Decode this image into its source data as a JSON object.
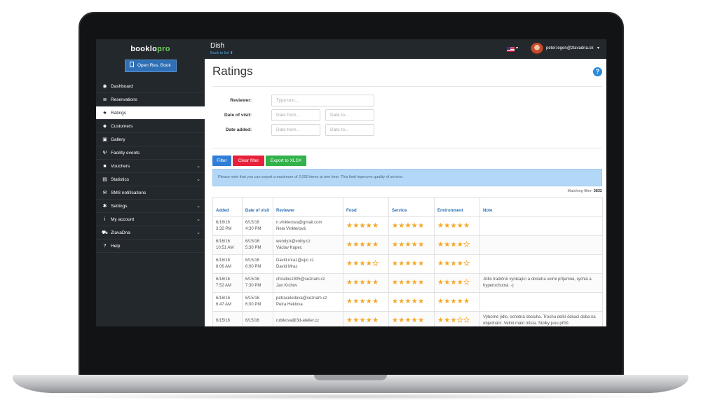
{
  "brand": {
    "name": "booklo",
    "suffix": "pro"
  },
  "header": {
    "venue": "Dish",
    "back_link": "Back to list",
    "user_email": "peter.legen@zlavadna.sk"
  },
  "sidebar": {
    "open_button": "Open Res. Book",
    "items": [
      {
        "label": "Dashboard",
        "icon": "dashboard-icon",
        "glyph": "◉"
      },
      {
        "label": "Reservations",
        "icon": "list-icon",
        "glyph": "≣"
      },
      {
        "label": "Ratings",
        "icon": "star-icon",
        "glyph": "★",
        "active": true
      },
      {
        "label": "Customers",
        "icon": "users-icon",
        "glyph": "☻"
      },
      {
        "label": "Gallery",
        "icon": "image-icon",
        "glyph": "▣"
      },
      {
        "label": "Facility events",
        "icon": "cutlery-icon",
        "glyph": "Ψ"
      },
      {
        "label": "Vouchers",
        "icon": "gift-icon",
        "glyph": "■",
        "chevron": true
      },
      {
        "label": "Statistics",
        "icon": "chart-icon",
        "glyph": "▤",
        "chevron": true
      },
      {
        "label": "SMS notifications",
        "icon": "envelope-icon",
        "glyph": "✉"
      },
      {
        "label": "Settings",
        "icon": "gear-icon",
        "glyph": "✱",
        "chevron": true
      },
      {
        "label": "My account",
        "icon": "info-icon",
        "glyph": "i",
        "chevron": true
      },
      {
        "label": "ZlavaDna",
        "icon": "cart-icon",
        "glyph": "⛟",
        "chevron": true
      },
      {
        "label": "Help",
        "icon": "help-icon",
        "glyph": "?"
      }
    ]
  },
  "page": {
    "title": "Ratings",
    "help": "?",
    "filters": {
      "reviewer_label": "Reviewer:",
      "reviewer_placeholder": "Type text...",
      "visit_label": "Date of visit:",
      "visit_from": "Date from...",
      "visit_to": "Date to...",
      "added_label": "Date added:",
      "added_from": "Date from...",
      "added_to": "Date to..."
    },
    "buttons": {
      "filter": "Filter",
      "clear": "Clear filter",
      "export": "Export to XLSX"
    },
    "notice": "Please note that you can export a maximum of 2,000 items at one time. This limit improves quality of service.",
    "matching_label": "Matching filter:",
    "matching_count": "3832",
    "colors": {
      "accent": "#2f7fd8",
      "danger": "#e8203a",
      "success": "#33b24a",
      "star": "#f5a623",
      "sidebar": "#23282d"
    }
  },
  "table": {
    "headers": [
      "Added",
      "Date of visit",
      "Reviewer",
      "Food",
      "Service",
      "Environment",
      "Note"
    ],
    "rows": [
      {
        "added_date": "6/16/16",
        "added_time": "3:32 PM",
        "visit_date": "6/15/16",
        "visit_time": "4:30 PM",
        "email": "n.vinklerova@gmail.com",
        "name": "Nela Vinklerová",
        "food": 5,
        "service": 5,
        "environment": 5,
        "note": ""
      },
      {
        "added_date": "6/16/16",
        "added_time": "10:51 AM",
        "visit_date": "6/15/16",
        "visit_time": "5:30 PM",
        "email": "wendy.k@volny.cz",
        "name": "Václav Kupec",
        "food": 5,
        "service": 5,
        "environment": 4,
        "note": ""
      },
      {
        "added_date": "6/16/16",
        "added_time": "8:06 AM",
        "visit_date": "6/15/16",
        "visit_time": "6:00 PM",
        "email": "David.mraz@upc.cz",
        "name": "David Mraz",
        "food": 4,
        "service": 5,
        "environment": 4,
        "note": ""
      },
      {
        "added_date": "6/16/16",
        "added_time": "7:52 AM",
        "visit_date": "6/15/16",
        "visit_time": "7:30 PM",
        "email": "chrudos1905@seznam.cz",
        "name": "Jan Krchov",
        "food": 5,
        "service": 5,
        "environment": 4,
        "note": "Jídlo tradičně vynikající a obsluha velmi příjemná, rychlá a hyperochotná :-)"
      },
      {
        "added_date": "6/16/16",
        "added_time": "6:47 AM",
        "visit_date": "6/15/16",
        "visit_time": "6:00 PM",
        "email": "petraceledova@seznam.cz",
        "name": "Petra Heklova",
        "food": 5,
        "service": 5,
        "environment": 5,
        "note": ""
      },
      {
        "added_date": "6/15/16",
        "added_time": "",
        "visit_date": "6/15/16",
        "visit_time": "",
        "email": "rubikova@3d-atelier.cz",
        "name": "",
        "food": 5,
        "service": 5,
        "environment": 3,
        "note": "Výborné jídlo, ochotná obsluha. Trochu delší čekací doba na objednání. Velmi málo místa. Stolky jsou příliš"
      }
    ]
  }
}
